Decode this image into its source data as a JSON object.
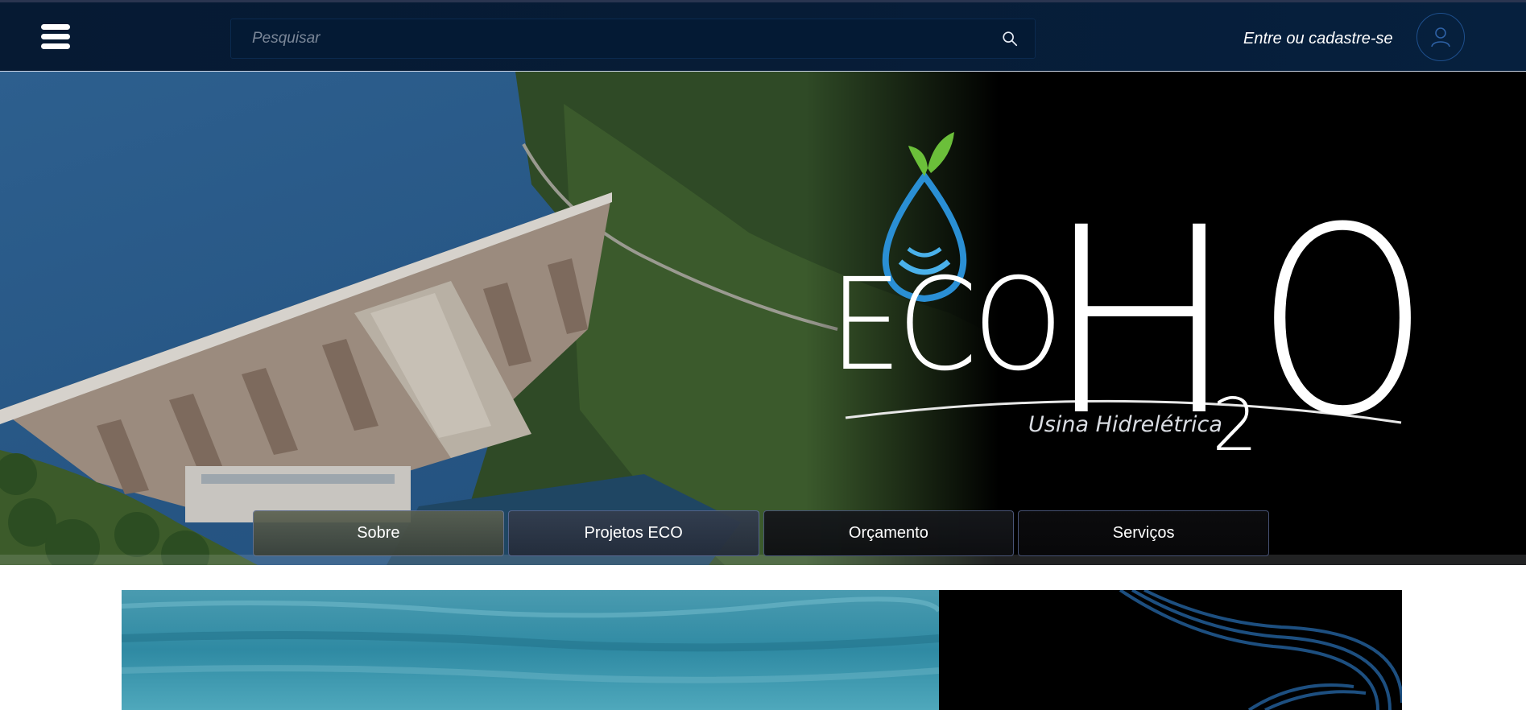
{
  "header": {
    "menu_icon": "hamburger-menu-icon",
    "search_placeholder": "Pesquisar",
    "search_icon": "search-icon",
    "login_label": "Entre ou cadastre-se",
    "user_icon": "user-icon"
  },
  "hero": {
    "logo_eco": "ECO",
    "logo_h": "H",
    "logo_sub": "2",
    "logo_o": "O",
    "tagline": "Usina Hidrelétrica"
  },
  "nav": {
    "items": [
      {
        "label": "Sobre"
      },
      {
        "label": "Projetos ECO"
      },
      {
        "label": "Orçamento"
      },
      {
        "label": "Serviços"
      }
    ]
  },
  "colors": {
    "header_bg": "#061a33",
    "accent_blue": "#1e4f8c",
    "logo_drop": "#2a8fd4",
    "logo_leaf": "#6bbf3a"
  }
}
